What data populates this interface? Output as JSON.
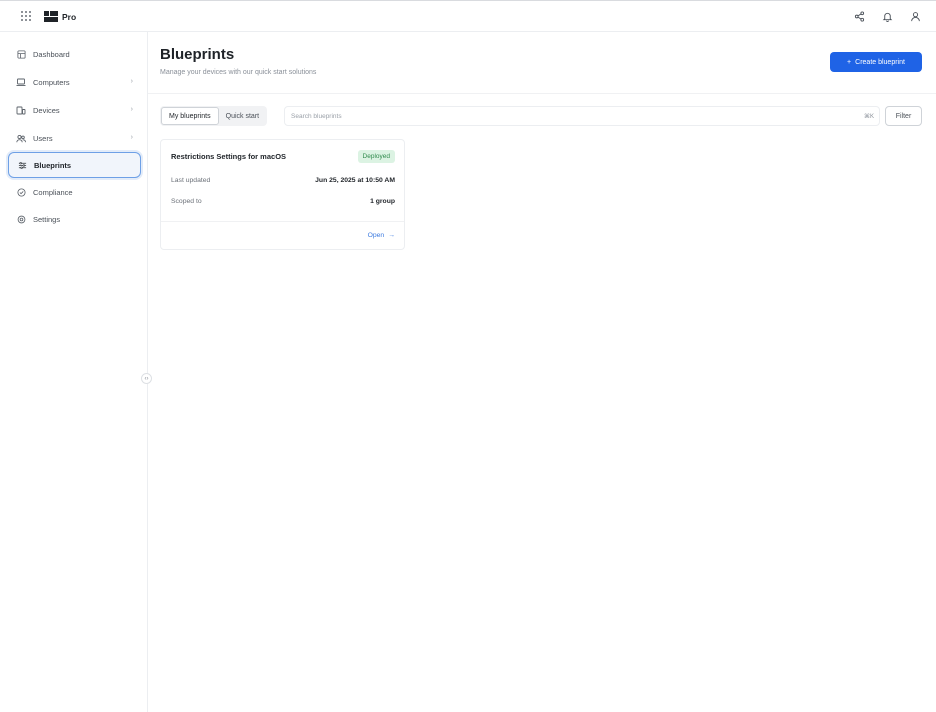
{
  "topbar": {
    "app_name": "Pro",
    "icons": [
      "apps-grid-icon",
      "share-icon",
      "bell-icon",
      "user-icon"
    ]
  },
  "sidebar": {
    "items": [
      {
        "label": "Dashboard",
        "icon": "dashboard-icon",
        "has_children": false,
        "active": false
      },
      {
        "label": "Computers",
        "icon": "laptop-icon",
        "has_children": true,
        "active": false
      },
      {
        "label": "Devices",
        "icon": "devices-icon",
        "has_children": true,
        "active": false
      },
      {
        "label": "Users",
        "icon": "users-icon",
        "has_children": true,
        "active": false
      },
      {
        "label": "Blueprints",
        "icon": "sliders-icon",
        "has_children": false,
        "active": true
      },
      {
        "label": "Compliance",
        "icon": "shield-check-icon",
        "has_children": false,
        "active": false
      },
      {
        "label": "Settings",
        "icon": "gear-icon",
        "has_children": false,
        "active": false
      }
    ],
    "chevron": "›",
    "collapse_glyph": "‹›"
  },
  "header": {
    "title": "Blueprints",
    "subtitle": "Manage your devices with our quick start solutions",
    "create_button": "Create blueprint",
    "create_button_icon": "+"
  },
  "toolbar": {
    "tabs": [
      {
        "label": "My blueprints",
        "active": true
      },
      {
        "label": "Quick start",
        "active": false
      }
    ],
    "search_placeholder": "Search blueprints",
    "search_shortcut": "⌘K",
    "filter_label": "Filter"
  },
  "cards": [
    {
      "title": "Restrictions Settings for macOS",
      "status": "Deployed",
      "last_updated_label": "Last updated",
      "last_updated_value": "Jun 25, 2025 at 10:50 AM",
      "scoped_label": "Scoped to",
      "scoped_value": "1 group",
      "open_label": "Open",
      "open_arrow": "→"
    }
  ],
  "colors": {
    "accent": "#1f63e6",
    "badge_bg": "#dcf3e3",
    "badge_text": "#2f8a4c",
    "active_border": "#6ea0e6"
  }
}
